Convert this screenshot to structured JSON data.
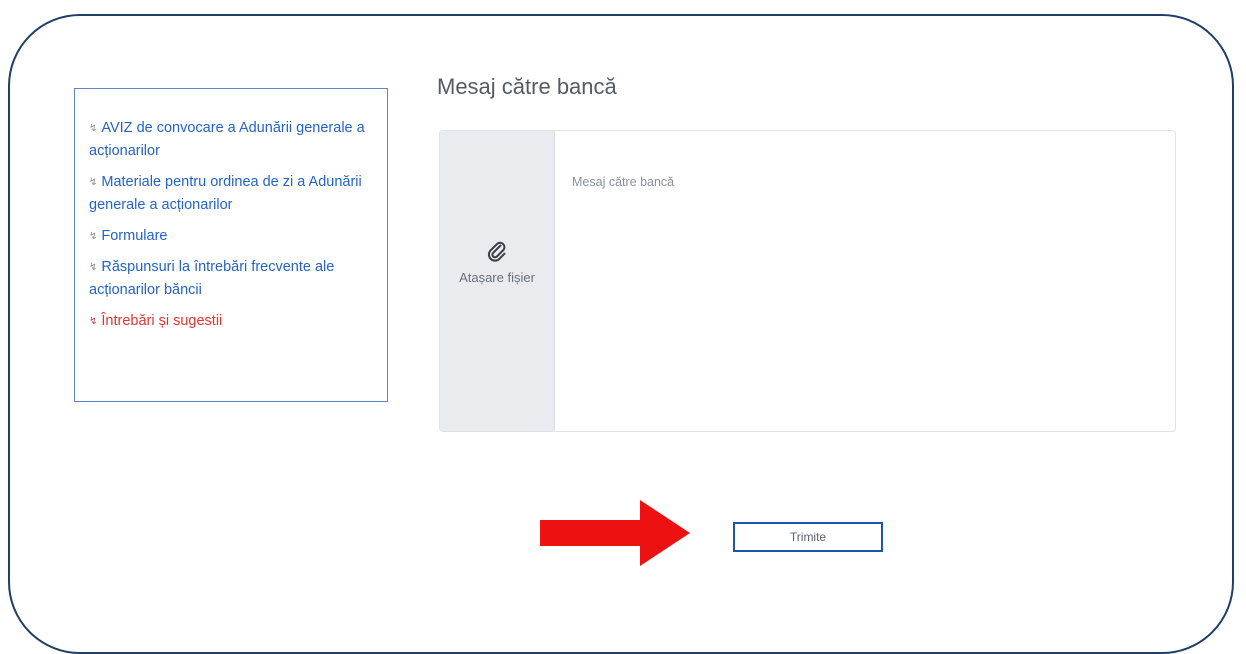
{
  "sidebar": {
    "items": [
      {
        "label": "AVIZ de convocare a Adunării generale a acționarilor",
        "active": false
      },
      {
        "label": "Materiale pentru ordinea de zi a Adunării generale a acționarilor",
        "active": false
      },
      {
        "label": "Formulare",
        "active": false
      },
      {
        "label": "Răspunsuri la întrebări frecvente ale acționarilor băncii",
        "active": false
      },
      {
        "label": "Întrebări și sugestii",
        "active": true
      }
    ]
  },
  "main": {
    "title": "Mesaj către bancă",
    "attach": {
      "icon": "paperclip-icon",
      "label": "Atașare fișier"
    },
    "message": {
      "placeholder": "Mesaj către bancă",
      "value": ""
    },
    "send_label": "Trimite"
  },
  "colors": {
    "frame_border": "#1f3f66",
    "link": "#2563c7",
    "active_link": "#e53333",
    "arrow": "#ee1111",
    "button_border": "#1f55a8"
  }
}
